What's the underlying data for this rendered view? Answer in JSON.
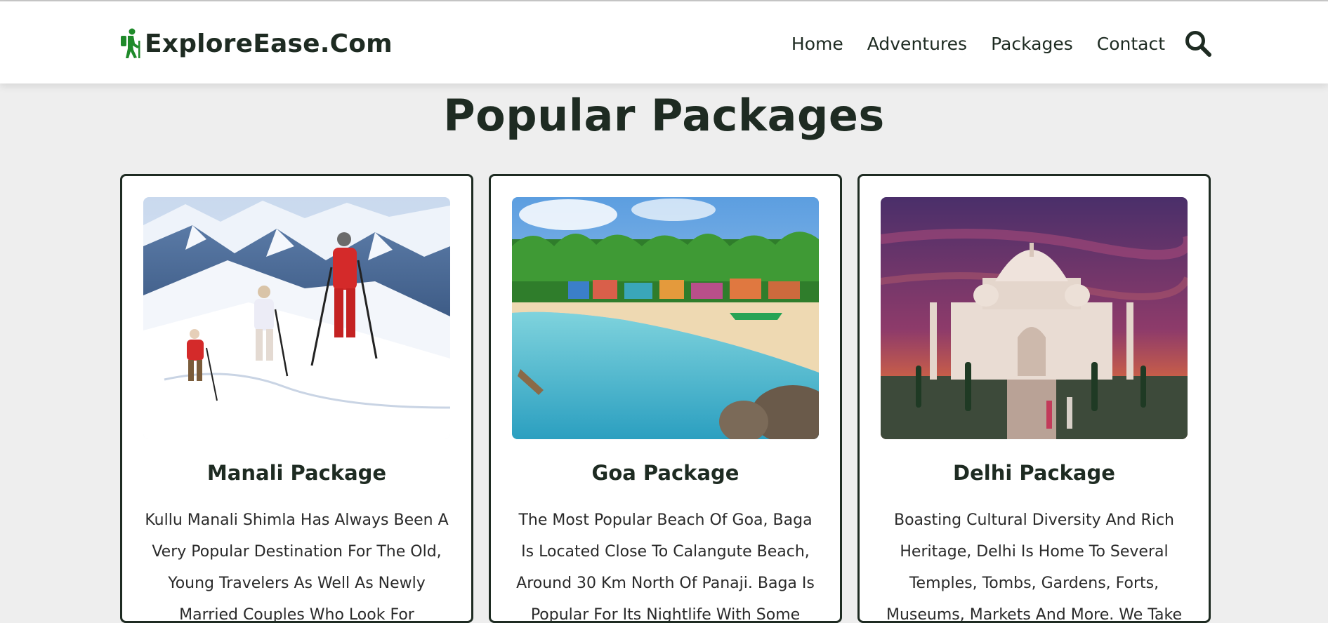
{
  "header": {
    "brand": "ExploreEase.Com",
    "nav": [
      "Home",
      "Adventures",
      "Packages",
      "Contact"
    ]
  },
  "section": {
    "title": "Popular Packages"
  },
  "packages": [
    {
      "title": "Manali Package",
      "description": "Kullu Manali Shimla Has Always Been A Very Popular Destination For The Old, Young Travelers As Well As Newly Married Couples Who Look For"
    },
    {
      "title": "Goa Package",
      "description": "The Most Popular Beach Of Goa, Baga Is Located Close To Calangute Beach, Around 30 Km North Of Panaji. Baga Is Popular For Its Nightlife With Some"
    },
    {
      "title": "Delhi Package",
      "description": "Boasting Cultural Diversity And Rich Heritage, Delhi Is Home To Several Temples, Tombs, Gardens, Forts, Museums, Markets And More. We Take"
    }
  ],
  "icons": {
    "logo": "hiking-person-icon",
    "search": "search-icon"
  },
  "colors": {
    "brand_green": "#1f8a2a",
    "text_dark": "#1e2b22",
    "page_bg": "#eeeeee"
  }
}
